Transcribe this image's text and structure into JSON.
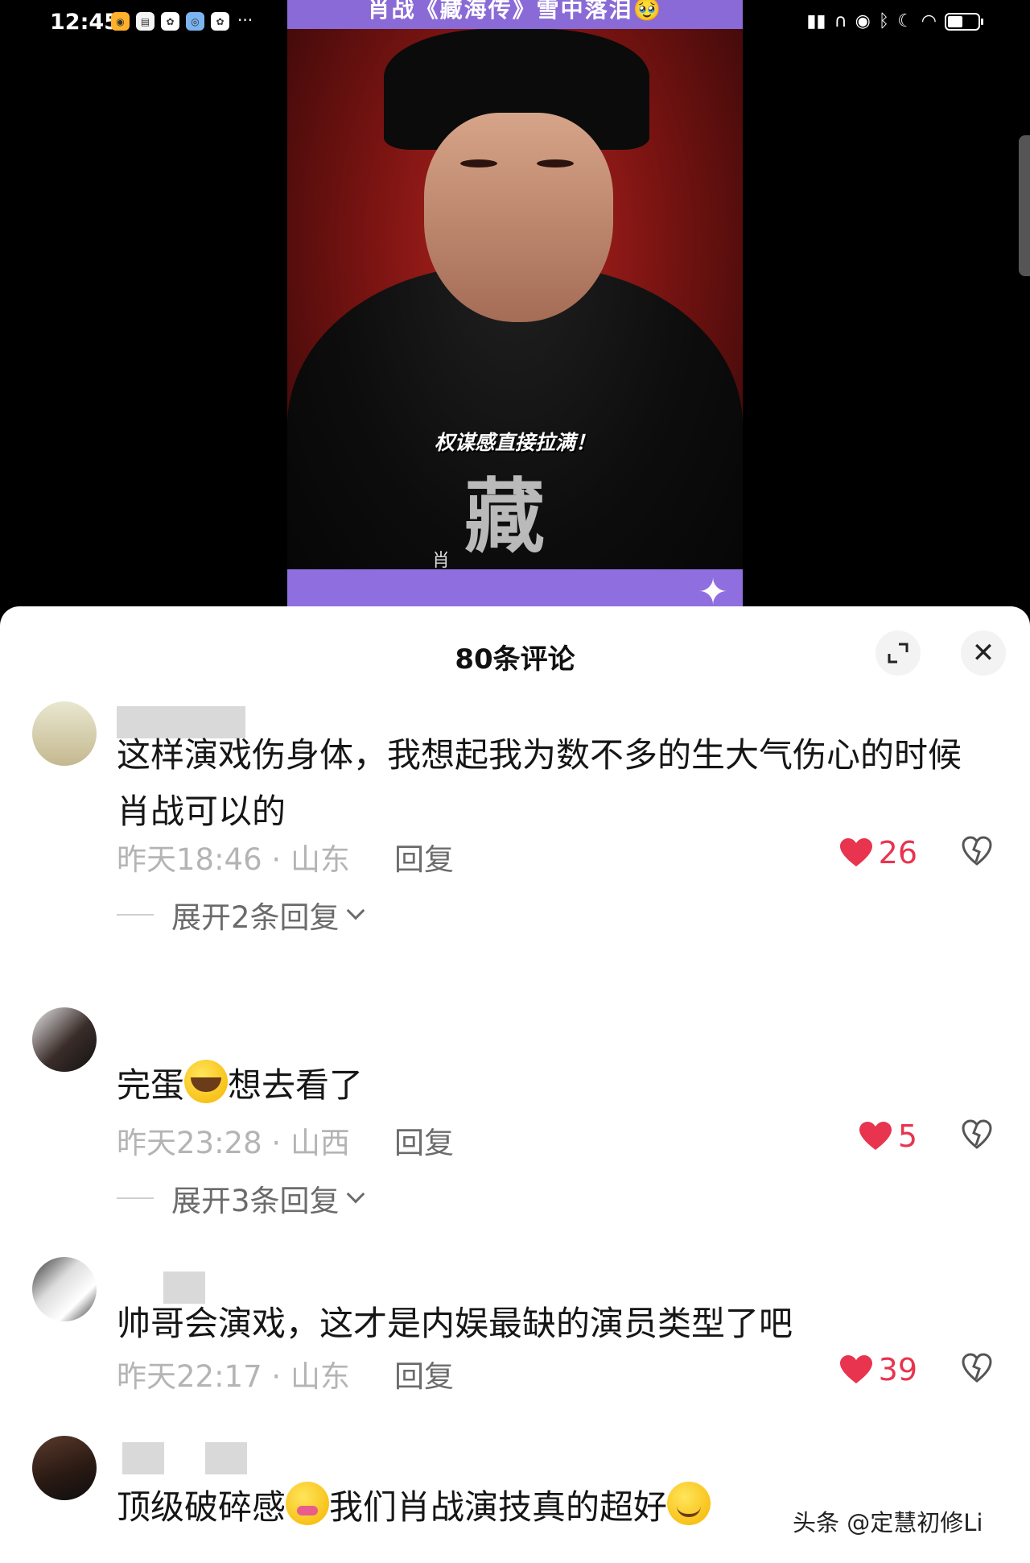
{
  "status_bar": {
    "time": "12:45",
    "app_icons": [
      "weibo-icon",
      "notes-icon",
      "baidu-icon",
      "browser-icon",
      "baidu-icon"
    ],
    "more": "···",
    "right_icons": [
      "sim-icon",
      "headphone-icon",
      "eye-icon",
      "bluetooth-icon",
      "moon-icon",
      "wifi-icon",
      "battery-icon"
    ]
  },
  "video": {
    "top_banner": "肖战《藏海传》雪中落泪🥹",
    "caption": "权谋感直接拉满！",
    "title_art": "藏",
    "author": "肖",
    "sparkle": "✦"
  },
  "sheet": {
    "title": "80条评论",
    "close": "✕"
  },
  "comments": [
    {
      "text": "这样演戏伤身体，我想起我为数不多的生大气伤心的时候 肖战可以的",
      "time": "昨天18:46",
      "location": "山东",
      "reply": "回复",
      "likes": "26",
      "expand": "展开2条回复"
    },
    {
      "text_before": "完蛋",
      "text_after": "想去看了",
      "time": "昨天23:28",
      "location": "山西",
      "reply": "回复",
      "likes": "5",
      "expand": "展开3条回复"
    },
    {
      "text": "帅哥会演戏，这才是内娱最缺的演员类型了吧",
      "time": "昨天22:17",
      "location": "山东",
      "reply": "回复",
      "likes": "39"
    },
    {
      "text_before": "顶级破碎感",
      "text_middle": "我们肖战演技真的超好"
    }
  ],
  "meta_separator": " · ",
  "watermark": "头条 @定慧初修Li",
  "colors": {
    "like": "#e8344f",
    "banner": "#8f6fe0"
  }
}
